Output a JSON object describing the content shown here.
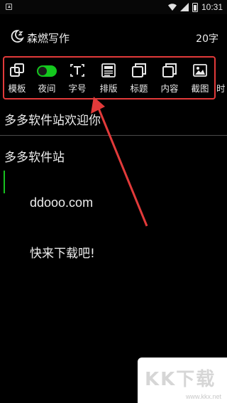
{
  "status_bar": {
    "time": "10:31"
  },
  "header": {
    "app_title": "森燃写作",
    "word_count": "20字"
  },
  "toolbar": {
    "items": [
      {
        "label": "模板",
        "icon": "template-icon"
      },
      {
        "label": "夜间",
        "icon": "night-toggle"
      },
      {
        "label": "字号",
        "icon": "font-size-icon"
      },
      {
        "label": "排版",
        "icon": "layout-icon"
      },
      {
        "label": "标题",
        "icon": "title-icon"
      },
      {
        "label": "内容",
        "icon": "content-icon"
      },
      {
        "label": "截图",
        "icon": "screenshot-icon"
      },
      {
        "label": "时",
        "icon": ""
      }
    ]
  },
  "document": {
    "title": "多多软件站欢迎你",
    "lines": [
      "多多软件站",
      "ddooo.com",
      "快来下载吧!"
    ]
  },
  "watermark": {
    "logo": "KK下载",
    "url": "www.kkx.net"
  },
  "colors": {
    "accent_green": "#14c81e",
    "annotation_red": "#e23a3a",
    "background": "#000000"
  }
}
